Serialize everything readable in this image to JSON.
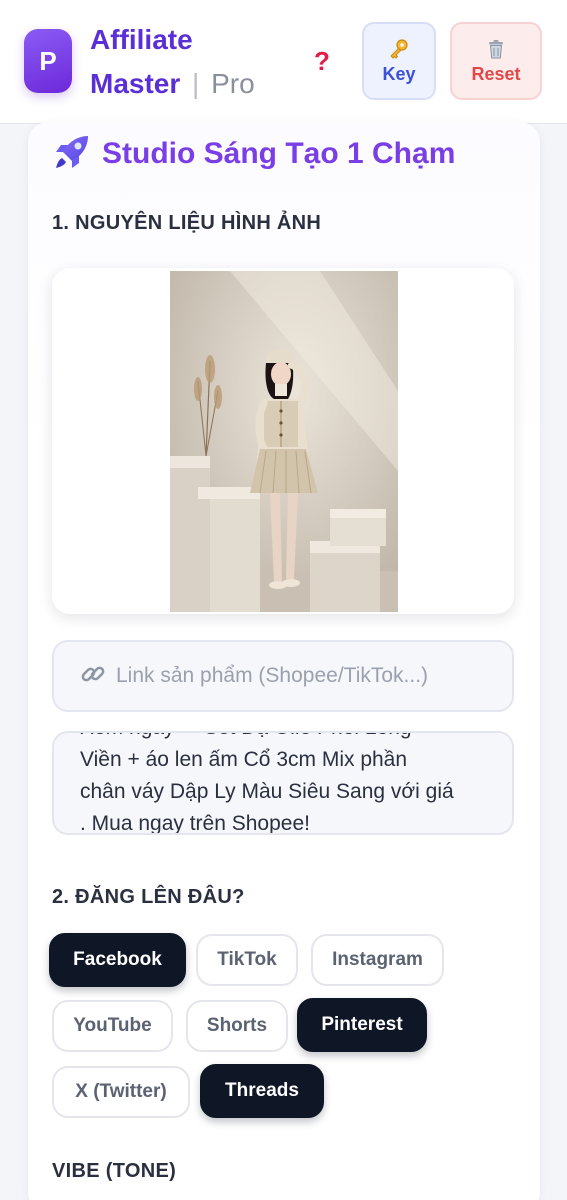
{
  "header": {
    "logo_letter": "P",
    "brand_line1": "Affiliate",
    "brand_line2_main": "Master",
    "brand_separator": "|",
    "brand_line2_suffix": "Pro",
    "help_glyph": "?",
    "key_button_label": "Key",
    "reset_button_label": "Reset",
    "icons": [
      "help-icon",
      "key-icon",
      "trash-icon"
    ]
  },
  "studio": {
    "title": "Studio Sáng Tạo 1 Chạm",
    "icon": "rocket-icon"
  },
  "section1": {
    "label": "1. NGUYÊN LIỆU HÌNH ẢNH",
    "link_placeholder": "Link sản phẩm (Shopee/TikTok...)",
    "description_lines": [
      "Xem ngay ✔ Set Dạ Olle Phối Long",
      "Viền + áo len ấm Cổ 3cm Mix phần",
      "chân váy Dập Ly Màu Siêu Sang với giá",
      ". Mua ngay trên Shopee!"
    ]
  },
  "section2": {
    "label": "2. ĐĂNG LÊN ĐÂU?",
    "platforms": [
      {
        "label": "Facebook",
        "selected": true
      },
      {
        "label": "TikTok",
        "selected": false
      },
      {
        "label": "Instagram",
        "selected": false
      },
      {
        "label": "YouTube",
        "selected": false
      },
      {
        "label": "Shorts",
        "selected": false
      },
      {
        "label": "Pinterest",
        "selected": true
      },
      {
        "label": "X (Twitter)",
        "selected": false
      },
      {
        "label": "Threads",
        "selected": true
      }
    ]
  },
  "vibe": {
    "label": "VIBE (TONE)"
  },
  "colors": {
    "brand_purple": "#5b2fd6",
    "title_purple": "#7a3ee6",
    "selected_chip": "#0f1626",
    "key_blue": "#3b4fd8",
    "reset_red": "#e24848"
  }
}
